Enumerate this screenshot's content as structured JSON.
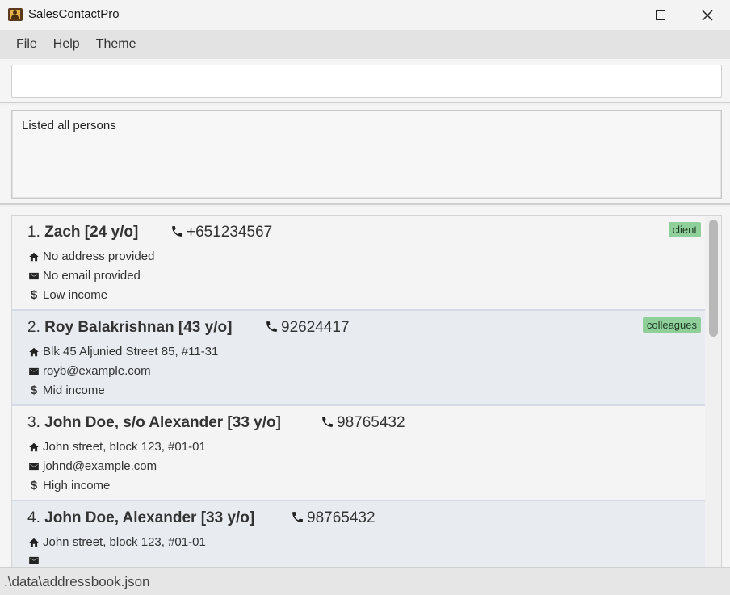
{
  "window": {
    "title": "SalesContactPro"
  },
  "menu": [
    "File",
    "Help",
    "Theme"
  ],
  "command": {
    "value": "",
    "placeholder": ""
  },
  "result": {
    "text": "Listed all persons"
  },
  "persons": [
    {
      "index": "1.",
      "name": "Zach [24 y/o]",
      "phone": "+651234567",
      "address": "No address provided",
      "email": "No email provided",
      "income": "Low income",
      "tag": "client"
    },
    {
      "index": "2.",
      "name": "Roy Balakrishnan [43 y/o]",
      "phone": "92624417",
      "address": "Blk 45 Aljunied Street 85, #11-31",
      "email": "royb@example.com",
      "income": "Mid income",
      "tag": "colleagues"
    },
    {
      "index": "3.",
      "name": "John Doe, s/o Alexander [33 y/o]",
      "phone": "98765432",
      "address": "John street, block 123, #01-01",
      "email": "johnd@example.com",
      "income": "High income",
      "tag": ""
    },
    {
      "index": "4.",
      "name": "John Doe, Alexander [33 y/o]",
      "phone": "98765432",
      "address": "John street, block 123, #01-01",
      "email": "",
      "income": "",
      "tag": ""
    }
  ],
  "status": {
    "path": ".\\data\\addressbook.json"
  },
  "icons": {
    "phone": "phone-icon",
    "address": "home-icon",
    "email": "envelope-icon",
    "income": "dollar-icon"
  },
  "colors": {
    "tag_bg": "#8fcf9a",
    "card_odd": "#f4f4f4",
    "card_even": "#e8ecf1"
  }
}
